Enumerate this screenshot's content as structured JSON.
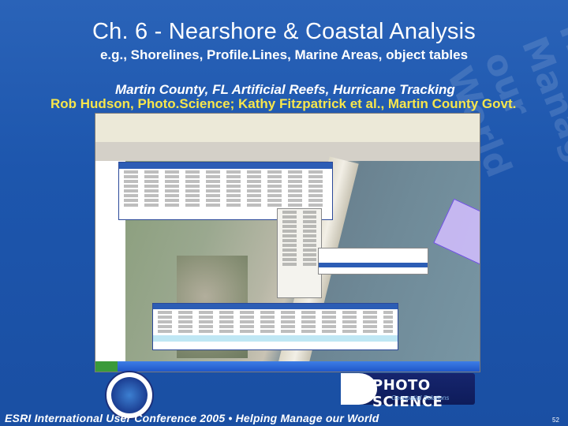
{
  "slide": {
    "title": "Ch. 6 - Nearshore & Coastal Analysis",
    "subtitle": "e.g., Shorelines, Profile.Lines, Marine Areas, object tables",
    "project_line": "Martin County, FL Artificial Reefs, Hurricane Tracking",
    "credits_line": "Rob Hudson, Photo.Science; Kathy Fitzpatrick et al., Martin County Govt.",
    "footer": "ESRI International User Conference 2005 • Helping Manage our World",
    "page_number": "52",
    "watermark_text": "Helping Manage our World"
  },
  "logos": {
    "photo_science_name": "PHOTO SCIENCE",
    "photo_science_tagline": "Geospatial Solutions"
  },
  "colors": {
    "background": "#1d56ad",
    "credits_text": "#f7e64b",
    "reef_polygon": "#d4beff"
  }
}
